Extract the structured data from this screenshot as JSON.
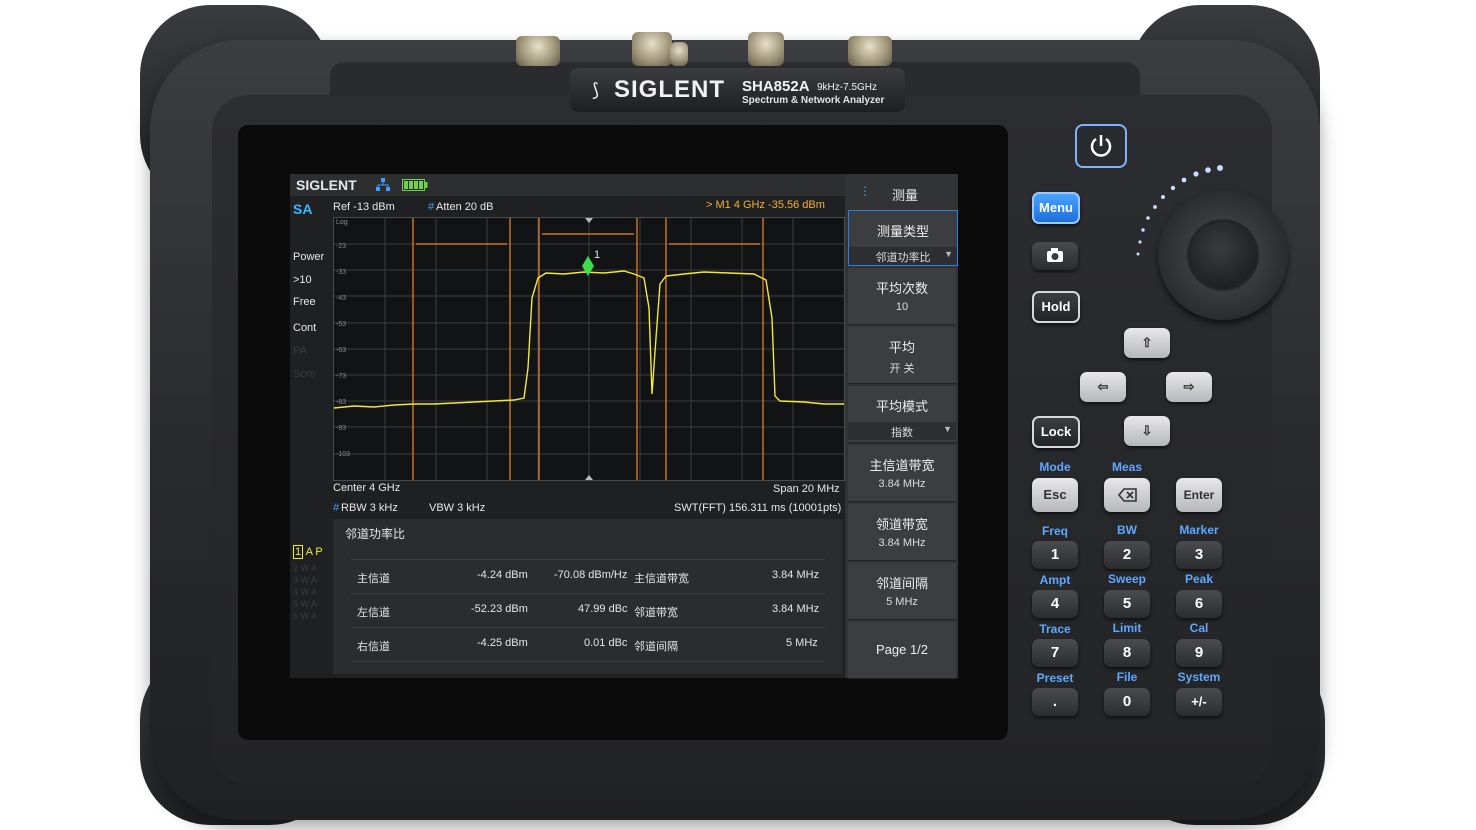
{
  "device": {
    "brand": "SIGLENT",
    "model": "SHA852A",
    "freq_range": "9kHz-7.5GHz",
    "subtitle": "Spectrum & Network Analyzer"
  },
  "screen": {
    "logo": "SIGLENT",
    "mode": "SA",
    "ref": "Ref  -13 dBm",
    "atten_hash": "#",
    "atten": "Atten  20 dB",
    "marker_readout": "> M1    4 GHz   -35.56 dBm",
    "scale": "Log",
    "y_ticks": [
      "-23",
      "-33",
      "-43",
      "-53",
      "-63",
      "-73",
      "-83",
      "-93",
      "-103"
    ],
    "left_status": [
      "Power",
      ">10",
      "Free",
      "Cont"
    ],
    "left_status_dim": [
      "PA",
      "Scre"
    ],
    "trace_status": {
      "num": "1",
      "letters": "A P"
    },
    "trace_status_dim": [
      "2 W A",
      "3 W A",
      "4 W A",
      "5 W A",
      "6 W A"
    ],
    "center": "Center  4 GHz",
    "span": "Span  20 MHz",
    "rbw_hash": "#",
    "rbw": "RBW  3 kHz",
    "vbw": "VBW  3 kHz",
    "swt": "SWT(FFT)  156.311 ms (10001pts)",
    "marker_label": "1"
  },
  "results": {
    "title": "邻道功率比",
    "rows": [
      {
        "name": "主信道",
        "power": "-4.24 dBm",
        "rel": "-70.08 dBm/Hz",
        "param": "主信道带宽",
        "pval": "3.84 MHz"
      },
      {
        "name": "左信道",
        "power": "-52.23 dBm",
        "rel": "47.99 dBc",
        "param": "邻道带宽",
        "pval": "3.84 MHz"
      },
      {
        "name": "右信道",
        "power": "-4.25 dBm",
        "rel": "0.01 dBc",
        "param": "邻道间隔",
        "pval": "5 MHz"
      }
    ]
  },
  "menu": {
    "title": "测量",
    "items": [
      {
        "label": "测量类型",
        "value": "邻道功率比"
      },
      {
        "label": "平均次数",
        "value": "10"
      },
      {
        "label": "平均",
        "value": "开  关"
      },
      {
        "label": "平均模式",
        "value": "指数"
      },
      {
        "label": "主信道带宽",
        "value": "3.84 MHz"
      },
      {
        "label": "领道带宽",
        "value": "3.84 MHz"
      },
      {
        "label": "邻道间隔",
        "value": "5 MHz"
      }
    ],
    "page": "Page 1/2"
  },
  "keys": {
    "menu": "Menu",
    "hold": "Hold",
    "lock": "Lock",
    "esc": "Esc",
    "enter": "Enter",
    "mode_label": "Mode",
    "meas_label": "Meas",
    "grid": [
      {
        "label": "Freq",
        "key": "1"
      },
      {
        "label": "BW",
        "key": "2"
      },
      {
        "label": "Marker",
        "key": "3"
      },
      {
        "label": "Ampt",
        "key": "4"
      },
      {
        "label": "Sweep",
        "key": "5"
      },
      {
        "label": "Peak",
        "key": "6"
      },
      {
        "label": "Trace",
        "key": "7"
      },
      {
        "label": "Limit",
        "key": "8"
      },
      {
        "label": "Cal",
        "key": "9"
      },
      {
        "label": "Preset",
        "key": "."
      },
      {
        "label": "File",
        "key": "0"
      },
      {
        "label": "System",
        "key": "+/-"
      }
    ]
  },
  "colors": {
    "trace": "#f2e93a",
    "marker": "#3ddc4a",
    "channel_lines": "#f08a24",
    "accent_blue": "#4aa3ff",
    "mode_sa": "#3fb7ff"
  }
}
